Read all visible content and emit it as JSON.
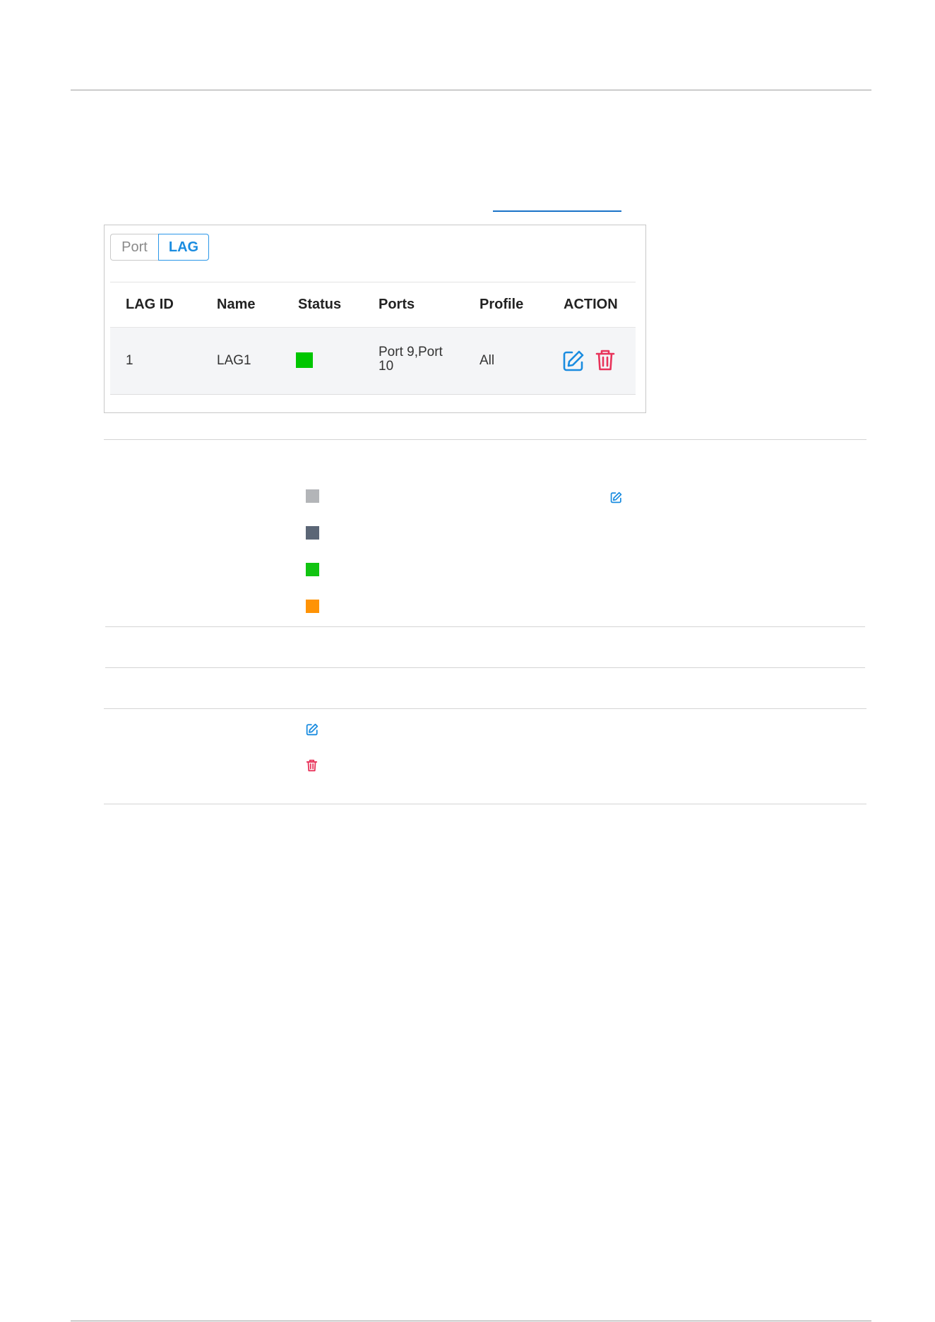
{
  "tabs": [
    {
      "label": "Port",
      "active": false
    },
    {
      "label": "LAG",
      "active": true
    }
  ],
  "table": {
    "headers": [
      "LAG ID",
      "Name",
      "Status",
      "Ports",
      "Profile",
      "ACTION"
    ],
    "rows": [
      {
        "lag_id": "1",
        "name": "LAG1",
        "status_color": "#00c600",
        "ports_line1": "Port 9,Port",
        "ports_line2": "10",
        "profile": "All"
      }
    ]
  },
  "legend_colors": [
    "#b3b5b8",
    "#5b6676",
    "#11c411",
    "#ff9305"
  ],
  "icons": {
    "edit": "edit-icon",
    "delete": "trash-icon"
  },
  "colors": {
    "accent": "#1a8ce0",
    "danger": "#e8335a"
  }
}
